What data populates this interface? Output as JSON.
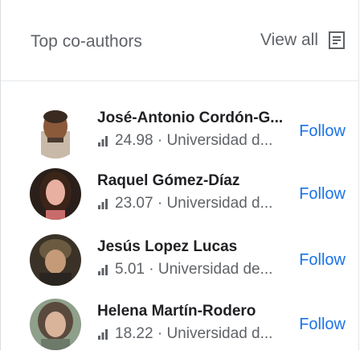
{
  "panel": {
    "title": "Top co-authors",
    "view_all_label": "View all",
    "view_all_icon": "list-icon"
  },
  "colors": {
    "link": "#1a73e8",
    "text_primary": "#202124",
    "text_secondary": "#5f6368",
    "divider": "#e8eaed"
  },
  "coauthors": [
    {
      "name": "José-Antonio Cordón-G...",
      "metric_icon": "bar-chart-icon",
      "metric": "24.98",
      "affiliation": "Universidad d...",
      "follow_label": "Follow"
    },
    {
      "name": "Raquel Gómez-Díaz",
      "metric_icon": "bar-chart-icon",
      "metric": "23.07",
      "affiliation": "Universidad d...",
      "follow_label": "Follow"
    },
    {
      "name": "Jesús Lopez Lucas",
      "metric_icon": "bar-chart-icon",
      "metric": "5.01",
      "affiliation": "Universidad de...",
      "follow_label": "Follow"
    },
    {
      "name": "Helena Martín-Rodero",
      "metric_icon": "bar-chart-icon",
      "metric": "18.22",
      "affiliation": "Universidad d...",
      "follow_label": "Follow"
    }
  ]
}
